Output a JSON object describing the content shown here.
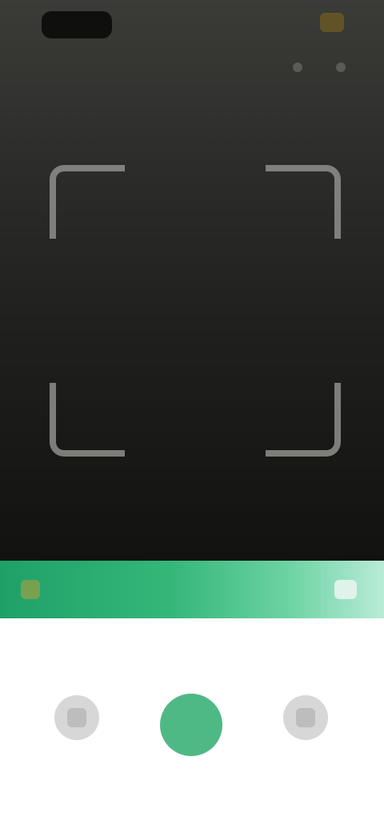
{
  "status_bar": {
    "time": "",
    "battery_color": "#6b5a22"
  },
  "camera_view": {
    "scan_frame_color": "#8f8f8b"
  },
  "green_bar": {
    "left_label": "",
    "right_label": "",
    "accent": "#35b77a"
  },
  "mode_tabs": [
    {
      "label": "",
      "active": false
    },
    {
      "label": "",
      "active": true
    },
    {
      "label": "",
      "active": false
    }
  ],
  "bottom_controls": {
    "left_button_label": "",
    "shutter_color": "#4fb985",
    "right_button_label": ""
  }
}
